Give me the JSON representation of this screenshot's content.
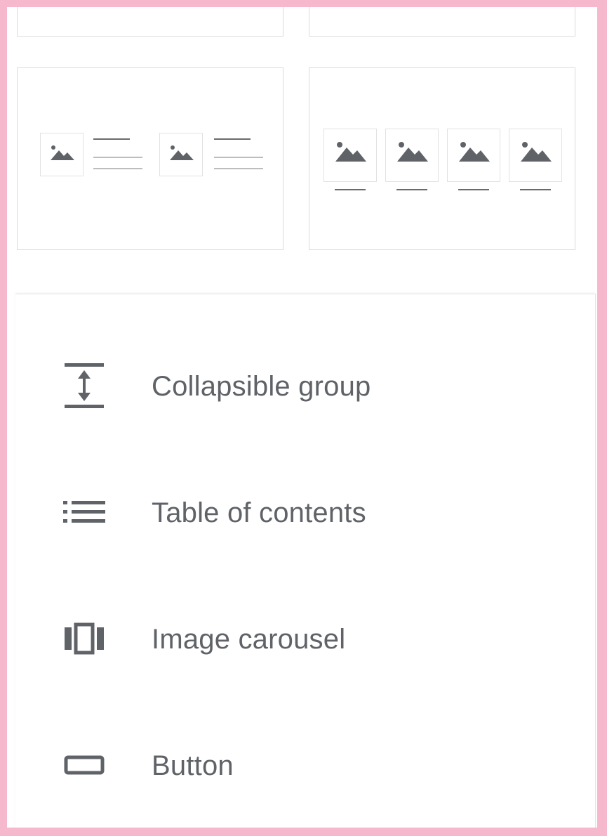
{
  "colors": {
    "frame": "#f6b8cc",
    "icon": "#5f6368",
    "text": "#5f6368",
    "tile_border": "#dcdcdc"
  },
  "layouts": [
    {
      "name": "two-image-with-text",
      "icon": "image-placeholder-icon"
    },
    {
      "name": "four-image-with-caption",
      "icon": "image-placeholder-icon"
    }
  ],
  "menu": {
    "items": [
      {
        "label": "Collapsible group",
        "icon": "collapsible-group-icon"
      },
      {
        "label": "Table of contents",
        "icon": "table-of-contents-icon"
      },
      {
        "label": "Image carousel",
        "icon": "image-carousel-icon"
      },
      {
        "label": "Button",
        "icon": "button-icon"
      }
    ]
  }
}
